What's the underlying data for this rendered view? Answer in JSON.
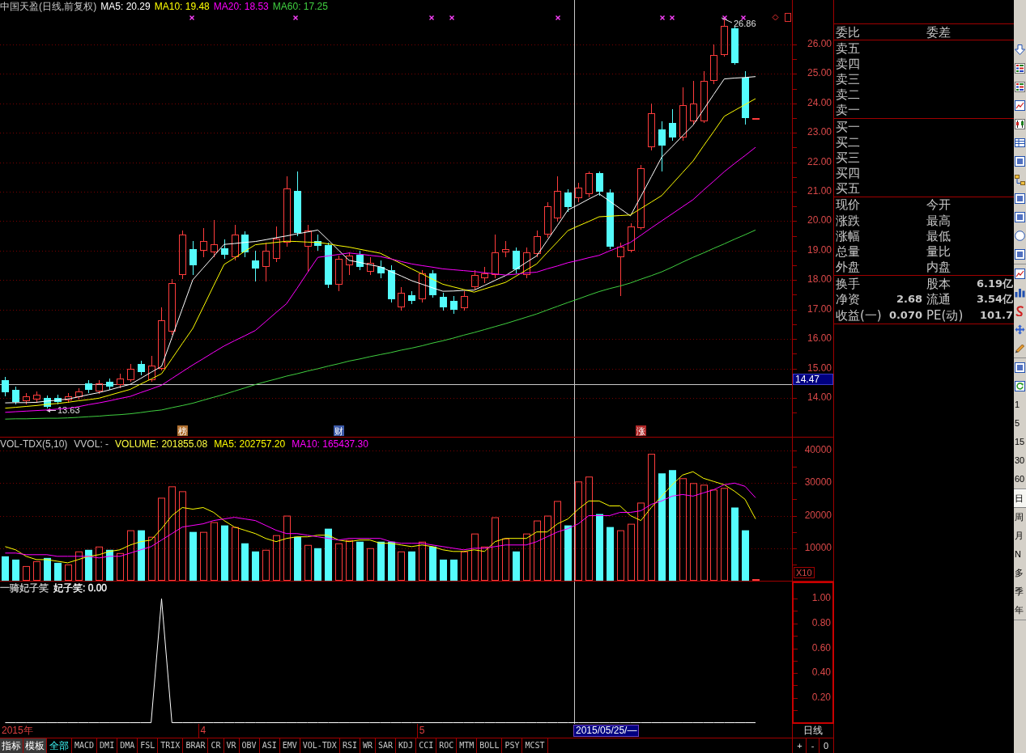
{
  "price_panel": {
    "legend": [
      {
        "text": "中国天盈(日线,前复权)",
        "color": "#c8c8c8"
      },
      {
        "text": "MA5: 20.29",
        "color": "#ffffff"
      },
      {
        "text": "MA10: 19.48",
        "color": "#ffff00"
      },
      {
        "text": "MA20: 18.53",
        "color": "#ff00ff"
      },
      {
        "text": "MA60: 17.25",
        "color": "#40d040"
      }
    ],
    "high_label": "26.86",
    "low_label": "13.63",
    "event_tags": [
      {
        "text": "榜",
        "color": "#b07030"
      },
      {
        "text": "财",
        "color": "#3c5aa8"
      },
      {
        "text": "涨",
        "color": "#b02828"
      }
    ],
    "chart_data": {
      "type": "candlestick",
      "categories": [
        null,
        null,
        null,
        null,
        null,
        null,
        null,
        null,
        null,
        null,
        null,
        null,
        null,
        null,
        null,
        null,
        null,
        null,
        null,
        null,
        null,
        null,
        null,
        null,
        null,
        null,
        null,
        null,
        null,
        null,
        null,
        null,
        null,
        null,
        null,
        null,
        null,
        null,
        null,
        null,
        null,
        null,
        null,
        null,
        null,
        null,
        null,
        null,
        null,
        null,
        null,
        null,
        null,
        null,
        null,
        null,
        null,
        null,
        null,
        null,
        null,
        null,
        null,
        null,
        null,
        null,
        null,
        null,
        null,
        null,
        null,
        null,
        null,
        null,
        null,
        null
      ],
      "ylim": [
        12.68,
        27.51
      ],
      "grid": true,
      "yticks": [
        {
          "value": 26,
          "label": "26.00"
        },
        {
          "value": 25,
          "label": "25.00"
        },
        {
          "value": 24,
          "label": "24.00"
        },
        {
          "value": 23,
          "label": "23.00"
        },
        {
          "value": 22,
          "label": "22.00"
        },
        {
          "value": 21,
          "label": "21.00"
        },
        {
          "value": 20,
          "label": "20.00"
        },
        {
          "value": 19,
          "label": "19.00"
        },
        {
          "value": 18,
          "label": "18.00"
        },
        {
          "value": 17,
          "label": "17.00"
        },
        {
          "value": 16,
          "label": "16.00"
        },
        {
          "value": 15,
          "label": "15.00"
        },
        {
          "value": 14,
          "label": "14.00"
        }
      ],
      "ref_lines": [
        {
          "axis": "y",
          "value": 14.47,
          "label": "14.47"
        }
      ],
      "ohlc": [
        [
          14.6,
          14.71,
          14.05,
          14.19
        ],
        [
          14.27,
          14.38,
          13.78,
          13.86
        ],
        [
          13.89,
          14.16,
          13.78,
          14.05
        ],
        [
          13.94,
          14.22,
          13.83,
          14.11
        ],
        [
          14.0,
          14.08,
          13.63,
          13.7
        ],
        [
          14.0,
          14.11,
          13.78,
          13.86
        ],
        [
          13.92,
          14.16,
          13.83,
          14.05
        ],
        [
          14.03,
          14.33,
          13.94,
          14.22
        ],
        [
          14.49,
          14.6,
          14.16,
          14.27
        ],
        [
          14.22,
          14.6,
          14.14,
          14.49
        ],
        [
          14.55,
          14.66,
          14.27,
          14.38
        ],
        [
          14.44,
          14.82,
          14.33,
          14.66
        ],
        [
          14.6,
          15.15,
          14.55,
          14.99
        ],
        [
          15.15,
          15.26,
          14.77,
          14.88
        ],
        [
          14.6,
          15.43,
          14.55,
          15.1
        ],
        [
          14.99,
          17.07,
          14.93,
          16.63
        ],
        [
          16.25,
          18.04,
          16.14,
          17.9
        ],
        [
          18.17,
          19.68,
          18.04,
          19.55
        ],
        [
          19.05,
          19.33,
          18.17,
          18.5
        ],
        [
          19.0,
          19.77,
          18.78,
          19.33
        ],
        [
          18.94,
          20.04,
          18.78,
          19.22
        ],
        [
          19.08,
          19.38,
          18.72,
          18.86
        ],
        [
          18.78,
          19.88,
          18.67,
          19.55
        ],
        [
          19.55,
          19.66,
          18.78,
          18.94
        ],
        [
          18.67,
          19.0,
          17.95,
          18.39
        ],
        [
          18.45,
          19.27,
          17.95,
          19.0
        ],
        [
          18.72,
          19.82,
          18.61,
          19.41
        ],
        [
          19.27,
          21.52,
          19.13,
          21.11
        ],
        [
          21.03,
          21.69,
          19.49,
          19.6
        ],
        [
          19.13,
          19.88,
          18.28,
          19.68
        ],
        [
          19.33,
          19.55,
          19.0,
          19.16
        ],
        [
          19.19,
          19.27,
          17.73,
          17.84
        ],
        [
          17.84,
          18.83,
          17.62,
          18.72
        ],
        [
          18.5,
          18.94,
          18.17,
          18.83
        ],
        [
          18.86,
          19.0,
          18.34,
          18.45
        ],
        [
          18.28,
          18.78,
          18.17,
          18.58
        ],
        [
          18.45,
          18.67,
          18.06,
          18.23
        ],
        [
          18.34,
          18.5,
          17.24,
          17.35
        ],
        [
          17.07,
          17.76,
          16.96,
          17.57
        ],
        [
          17.49,
          17.62,
          17.18,
          17.29
        ],
        [
          17.35,
          18.34,
          17.24,
          18.23
        ],
        [
          18.23,
          18.34,
          17.4,
          17.49
        ],
        [
          17.43,
          17.57,
          16.96,
          17.07
        ],
        [
          17.29,
          17.46,
          16.85,
          16.99
        ],
        [
          17.05,
          17.62,
          16.96,
          17.46
        ],
        [
          17.76,
          18.34,
          17.68,
          18.17
        ],
        [
          18.06,
          18.45,
          17.9,
          18.23
        ],
        [
          18.17,
          19.55,
          18.06,
          18.94
        ],
        [
          18.94,
          19.33,
          18.78,
          19.05
        ],
        [
          19.0,
          19.11,
          18.23,
          18.36
        ],
        [
          18.17,
          19.11,
          18.06,
          18.94
        ],
        [
          18.89,
          19.68,
          18.78,
          19.49
        ],
        [
          19.55,
          20.64,
          19.44,
          20.51
        ],
        [
          20.1,
          21.52,
          19.99,
          21.03
        ],
        [
          20.97,
          21.08,
          20.31,
          20.48
        ],
        [
          20.78,
          21.3,
          20.64,
          21.14
        ],
        [
          20.92,
          21.69,
          20.81,
          21.63
        ],
        [
          21.63,
          21.69,
          20.86,
          21.0
        ],
        [
          20.97,
          21.08,
          19.05,
          19.13
        ],
        [
          18.78,
          19.27,
          17.46,
          19.13
        ],
        [
          19.0,
          19.93,
          18.94,
          19.82
        ],
        [
          19.77,
          21.91,
          19.71,
          21.8
        ],
        [
          22.51,
          23.99,
          22.4,
          23.67
        ],
        [
          23.12,
          23.39,
          21.69,
          22.57
        ],
        [
          23.34,
          23.8,
          22.73,
          22.84
        ],
        [
          22.84,
          24.54,
          22.73,
          23.94
        ],
        [
          23.39,
          24.76,
          23.28,
          23.99
        ],
        [
          23.39,
          25.09,
          23.34,
          24.76
        ],
        [
          24.76,
          26.0,
          24.65,
          25.64
        ],
        [
          25.64,
          26.86,
          25.59,
          26.63
        ],
        [
          26.55,
          26.6,
          25.31,
          25.37
        ],
        [
          24.87,
          25.09,
          23.28,
          23.5
        ],
        [
          23.45,
          23.5,
          23.45,
          23.5
        ],
        null,
        null,
        null
      ],
      "series": [
        {
          "type": "line",
          "color": "#ffffff",
          "values": [
            13.83,
            13.84,
            13.84,
            13.85,
            13.89,
            13.92,
            13.96,
            14.03,
            14.11,
            14.18,
            14.27,
            14.37,
            14.46,
            14.66,
            14.87,
            15.07,
            16.05,
            17.03,
            18.01,
            18.41,
            18.81,
            19.21,
            19.24,
            19.28,
            19.31,
            19.37,
            19.44,
            19.5,
            19.57,
            19.63,
            19.7,
            19.36,
            19.01,
            18.67,
            18.6,
            18.52,
            18.45,
            18.29,
            18.14,
            17.98,
            17.86,
            17.74,
            17.62,
            17.63,
            17.65,
            17.66,
            17.82,
            17.99,
            18.15,
            18.37,
            18.6,
            18.82,
            19.34,
            19.86,
            20.38,
            20.56,
            20.75,
            20.93,
            20.68,
            20.43,
            20.18,
            20.84,
            21.51,
            22.17,
            22.53,
            22.9,
            23.26,
            23.78,
            24.31,
            24.83,
            24.86,
            24.88,
            24.91,
            null,
            null,
            null
          ]
        },
        {
          "type": "line",
          "color": "#ffff00",
          "values": [
            13.65,
            13.68,
            13.71,
            13.74,
            13.78,
            13.81,
            13.85,
            13.9,
            13.94,
            13.99,
            14.09,
            14.19,
            14.29,
            14.47,
            14.64,
            14.82,
            15.33,
            15.85,
            16.36,
            17.08,
            17.81,
            18.53,
            18.75,
            18.98,
            19.2,
            19.24,
            19.28,
            19.32,
            19.31,
            19.29,
            19.28,
            19.23,
            19.17,
            19.12,
            19.05,
            18.98,
            18.91,
            18.73,
            18.56,
            18.38,
            18.21,
            18.03,
            17.86,
            17.77,
            17.68,
            17.59,
            17.7,
            17.81,
            17.92,
            18.13,
            18.34,
            18.55,
            18.93,
            19.3,
            19.68,
            19.84,
            19.99,
            20.15,
            20.17,
            20.19,
            20.21,
            20.43,
            20.65,
            20.87,
            21.26,
            21.65,
            22.04,
            22.55,
            23.05,
            23.56,
            23.76,
            23.96,
            24.16,
            null,
            null,
            null
          ]
        },
        {
          "type": "line",
          "color": "#ff00ff",
          "values": [
            13.51,
            13.53,
            13.55,
            13.57,
            13.59,
            13.62,
            13.64,
            13.7,
            13.77,
            13.83,
            13.9,
            13.98,
            14.05,
            14.18,
            14.3,
            14.43,
            14.66,
            14.89,
            15.12,
            15.33,
            15.55,
            15.76,
            15.94,
            16.11,
            16.29,
            16.59,
            16.9,
            17.2,
            17.72,
            18.25,
            18.77,
            18.82,
            18.87,
            18.92,
            18.88,
            18.84,
            18.8,
            18.72,
            18.63,
            18.55,
            18.49,
            18.44,
            18.38,
            18.35,
            18.32,
            18.29,
            18.25,
            18.21,
            18.17,
            18.2,
            18.24,
            18.27,
            18.38,
            18.48,
            18.59,
            18.67,
            18.76,
            18.84,
            18.99,
            19.13,
            19.28,
            19.52,
            19.77,
            20.01,
            20.25,
            20.49,
            20.73,
            21.05,
            21.36,
            21.68,
            21.96,
            22.23,
            22.51,
            null,
            null,
            null
          ]
        },
        {
          "type": "line",
          "color": "#40d040",
          "values": [
            13.28,
            13.29,
            13.29,
            13.3,
            13.31,
            13.31,
            13.32,
            13.34,
            13.36,
            13.38,
            13.41,
            13.43,
            13.46,
            13.5,
            13.55,
            13.59,
            13.67,
            13.74,
            13.82,
            13.92,
            14.02,
            14.12,
            14.23,
            14.34,
            14.45,
            14.55,
            14.64,
            14.74,
            14.82,
            14.91,
            14.99,
            15.08,
            15.16,
            15.25,
            15.32,
            15.4,
            15.47,
            15.54,
            15.62,
            15.69,
            15.77,
            15.86,
            15.94,
            16.03,
            16.13,
            16.22,
            16.32,
            16.42,
            16.52,
            16.63,
            16.74,
            16.85,
            16.98,
            17.11,
            17.24,
            17.36,
            17.49,
            17.61,
            17.71,
            17.8,
            17.9,
            18.03,
            18.15,
            18.28,
            18.44,
            18.61,
            18.77,
            18.92,
            19.08,
            19.23,
            19.39,
            19.54,
            19.7,
            null,
            null,
            null
          ]
        }
      ]
    }
  },
  "volume_panel": {
    "legend": [
      {
        "text": "VOL-TDX(5,10)",
        "color": "#c8c8c8"
      },
      {
        "text": "VVOL: -",
        "color": "#c8c8c8"
      },
      {
        "text": "VOLUME: 201855.08",
        "color": "#ffff40"
      },
      {
        "text": "MA5: 202757.20",
        "color": "#ffff00"
      },
      {
        "text": "MA10: 165437.30",
        "color": "#ff00ff"
      }
    ],
    "scale_label": "X10",
    "chart_data": {
      "type": "bar",
      "stacked": true,
      "grid": true,
      "categories": [
        null,
        null,
        null,
        null,
        null,
        null,
        null,
        null,
        null,
        null,
        null,
        null,
        null,
        null,
        null,
        null,
        null,
        null,
        null,
        null,
        null,
        null,
        null,
        null,
        null,
        null,
        null,
        null,
        null,
        null,
        null,
        null,
        null,
        null,
        null,
        null,
        null,
        null,
        null,
        null,
        null,
        null,
        null,
        null,
        null,
        null,
        null,
        null,
        null,
        null,
        null,
        null,
        null,
        null,
        null,
        null,
        null,
        null,
        null,
        null,
        null,
        null,
        null,
        null,
        null,
        null,
        null,
        null,
        null,
        null,
        null,
        null,
        null,
        null,
        null,
        null
      ],
      "ylim": [
        0,
        44000
      ],
      "yticks": [
        {
          "value": 10000,
          "label": "10000"
        },
        {
          "value": 20000,
          "label": "20000"
        },
        {
          "value": 30000,
          "label": "30000"
        },
        {
          "value": 40000,
          "label": "40000"
        }
      ],
      "series": [
        {
          "color": "#ff3c3c",
          "values": [
            null,
            null,
            4500,
            6000,
            null,
            null,
            5000,
            9000,
            null,
            10500,
            null,
            8500,
            15500,
            null,
            13500,
            25500,
            29000,
            27500,
            null,
            15000,
            18000,
            null,
            16500,
            null,
            null,
            9500,
            14000,
            20000,
            null,
            11000,
            null,
            null,
            11500,
            12500,
            null,
            10000,
            null,
            null,
            9000,
            null,
            12000,
            null,
            null,
            null,
            9000,
            14500,
            10500,
            19500,
            13000,
            null,
            14500,
            18500,
            20000,
            24500,
            null,
            30500,
            32000,
            null,
            null,
            15500,
            17500,
            24000,
            39000,
            null,
            null,
            31500,
            30000,
            29500,
            28000,
            28500,
            null,
            null,
            500,
            null,
            null,
            null
          ]
        },
        {
          "color": "#54fcfc",
          "values": [
            7500,
            6500,
            null,
            null,
            7000,
            5500,
            null,
            null,
            9500,
            null,
            9500,
            null,
            null,
            15500,
            null,
            null,
            null,
            null,
            15000,
            null,
            null,
            17000,
            null,
            11500,
            9000,
            null,
            null,
            null,
            13500,
            null,
            10000,
            16000,
            null,
            null,
            12000,
            null,
            12000,
            12000,
            null,
            9000,
            null,
            10500,
            6500,
            6500,
            null,
            null,
            null,
            null,
            null,
            9000,
            null,
            null,
            null,
            null,
            17000,
            null,
            null,
            20500,
            16500,
            null,
            null,
            null,
            null,
            33000,
            34000,
            null,
            null,
            null,
            null,
            null,
            22500,
            15500,
            null,
            null,
            null,
            null
          ]
        },
        {
          "type": "line",
          "color": "#ffff00",
          "values": [
            10500,
            9500,
            7500,
            6500,
            6500,
            6000,
            5500,
            6500,
            7500,
            8000,
            9000,
            9500,
            11000,
            12000,
            12500,
            16000,
            20000,
            22500,
            22000,
            22500,
            21000,
            18500,
            16500,
            15500,
            14500,
            13000,
            12000,
            13000,
            13500,
            13500,
            14000,
            14000,
            12500,
            12000,
            12500,
            12500,
            11500,
            11500,
            11000,
            10500,
            11000,
            10500,
            9500,
            9000,
            9000,
            9500,
            9000,
            12000,
            13000,
            13000,
            13000,
            15000,
            15000,
            17500,
            19000,
            22000,
            24500,
            24500,
            23000,
            23000,
            20000,
            18500,
            22500,
            26000,
            29500,
            32500,
            33500,
            31500,
            30500,
            29500,
            27500,
            25000,
            19000,
            null,
            null,
            null
          ]
        },
        {
          "type": "line",
          "color": "#ff00ff",
          "values": [
            8500,
            8500,
            8000,
            8000,
            8000,
            7500,
            7500,
            7500,
            7500,
            7000,
            7500,
            7500,
            8500,
            9500,
            10500,
            12500,
            14500,
            16500,
            17000,
            17500,
            18500,
            19000,
            19500,
            19000,
            18500,
            17000,
            15500,
            14500,
            14500,
            14000,
            13500,
            13000,
            12500,
            13000,
            13000,
            13000,
            13000,
            12000,
            11500,
            11500,
            11500,
            11000,
            10500,
            10000,
            9500,
            10000,
            10000,
            10500,
            11000,
            11000,
            11000,
            12000,
            13500,
            15000,
            16000,
            17500,
            20000,
            20000,
            20000,
            21000,
            21000,
            21500,
            23500,
            24500,
            26000,
            26500,
            26000,
            27000,
            28000,
            29500,
            30000,
            29000,
            25500,
            null,
            null,
            null
          ]
        }
      ]
    }
  },
  "indicator_panel": {
    "legend": [
      {
        "text": "一骑妃子笑",
        "color": "#c8c8c8"
      },
      {
        "text": "妃子笑: 0.00",
        "color": "#ffffff"
      }
    ],
    "chart_data": {
      "type": "line",
      "categories": [
        null,
        null,
        null,
        null,
        null,
        null,
        null,
        null,
        null,
        null,
        null,
        null,
        null,
        null,
        null,
        null,
        null,
        null,
        null,
        "4",
        null,
        null,
        null,
        null,
        null,
        null,
        null,
        null,
        null,
        null,
        null,
        null,
        null,
        null,
        null,
        null,
        null,
        null,
        null,
        null,
        "5",
        null,
        null,
        null,
        null,
        null,
        null,
        null,
        null,
        null,
        null,
        null,
        null,
        null,
        null,
        null,
        null,
        null,
        null,
        null,
        null,
        null,
        null,
        null,
        null,
        null,
        null,
        null,
        null,
        null,
        null,
        null,
        null,
        null,
        null,
        null
      ],
      "ylim": [
        -0.01,
        1.14
      ],
      "yticks": [
        {
          "value": 0.2,
          "label": "0.20"
        },
        {
          "value": 0.4,
          "label": "0.40"
        },
        {
          "value": 0.6,
          "label": "0.60"
        },
        {
          "value": 0.8,
          "label": "0.80"
        },
        {
          "value": 1,
          "label": "1.00"
        }
      ],
      "series": [
        {
          "color": "#ffffff",
          "values": [
            0,
            0,
            0,
            0,
            0,
            0,
            0,
            0,
            0,
            0,
            0,
            0,
            0,
            0,
            0,
            1,
            0,
            0,
            0,
            0,
            0,
            0,
            0,
            0,
            0,
            0,
            0,
            0,
            0,
            0,
            0,
            0,
            0,
            0,
            0,
            0,
            0,
            0,
            0,
            0,
            0,
            0,
            0,
            0,
            0,
            0,
            0,
            0,
            0,
            0,
            0,
            0,
            0,
            0,
            0,
            0,
            0,
            0,
            0,
            0,
            0,
            0,
            0,
            0,
            0,
            0,
            0,
            0,
            0,
            0,
            0,
            0,
            0,
            null,
            null,
            null
          ]
        }
      ]
    }
  },
  "date_axis": {
    "year_label": "2015年",
    "crosshair_date": "2015/05/25/—",
    "period": "日线"
  },
  "tab_bar": {
    "menus": [
      "指标",
      "模板"
    ],
    "tabs": [
      {
        "label": "全部",
        "selected": true
      },
      {
        "label": "MACD",
        "selected": false
      },
      {
        "label": "DMI",
        "selected": false
      },
      {
        "label": "DMA",
        "selected": false
      },
      {
        "label": "FSL",
        "selected": false
      },
      {
        "label": "TRIX",
        "selected": false
      },
      {
        "label": "BRAR",
        "selected": false
      },
      {
        "label": "CR",
        "selected": false
      },
      {
        "label": "VR",
        "selected": false
      },
      {
        "label": "OBV",
        "selected": false
      },
      {
        "label": "ASI",
        "selected": false
      },
      {
        "label": "EMV",
        "selected": false
      },
      {
        "label": "VOL-TDX",
        "selected": false
      },
      {
        "label": "RSI",
        "selected": false
      },
      {
        "label": "WR",
        "selected": false
      },
      {
        "label": "SAR",
        "selected": false
      },
      {
        "label": "KDJ",
        "selected": false
      },
      {
        "label": "CCI",
        "selected": false
      },
      {
        "label": "ROC",
        "selected": false
      },
      {
        "label": "MTM",
        "selected": false
      },
      {
        "label": "BOLL",
        "selected": false
      },
      {
        "label": "PSY",
        "selected": false
      },
      {
        "label": "MCST",
        "selected": false
      }
    ],
    "zoom_buttons": [
      "+",
      "-",
      "0"
    ]
  },
  "quote_panel": {
    "ratio_row": {
      "label": "委比",
      "label_2": "委差"
    },
    "sell_levels": [
      "卖五",
      "卖四",
      "卖三",
      "卖二",
      "卖一"
    ],
    "buy_levels": [
      "买一",
      "买二",
      "买三",
      "买四",
      "买五"
    ],
    "quote_rows": [
      {
        "label": "现价",
        "label_2": "今开"
      },
      {
        "label": "涨跌",
        "label_2": "最高"
      },
      {
        "label": "涨幅",
        "label_2": "最低"
      },
      {
        "label": "总量",
        "label_2": "量比"
      },
      {
        "label": "外盘",
        "label_2": "内盘"
      }
    ],
    "fundamentals": [
      {
        "label": "换手",
        "label_2": "股本",
        "value_2": "6.19亿"
      },
      {
        "label": "净资",
        "value": "2.68",
        "label_2": "流通",
        "value_2": "3.54亿"
      },
      {
        "label": "收益(一)",
        "value": "0.070",
        "label_2": "PE(动)",
        "value_2": "101.7"
      }
    ]
  },
  "side_toolbar": {
    "minute_periods": [
      {
        "label": "1",
        "selected": false
      },
      {
        "label": "5",
        "selected": false
      },
      {
        "label": "15",
        "selected": false
      },
      {
        "label": "30",
        "selected": false
      },
      {
        "label": "60",
        "selected": false
      }
    ],
    "periods": [
      {
        "label": "日",
        "selected": true
      },
      {
        "label": "周",
        "selected": false
      },
      {
        "label": "月",
        "selected": false
      },
      {
        "label": "N",
        "selected": false
      },
      {
        "label": "多",
        "selected": false
      },
      {
        "label": "季",
        "selected": false
      },
      {
        "label": "年",
        "selected": false
      }
    ]
  }
}
